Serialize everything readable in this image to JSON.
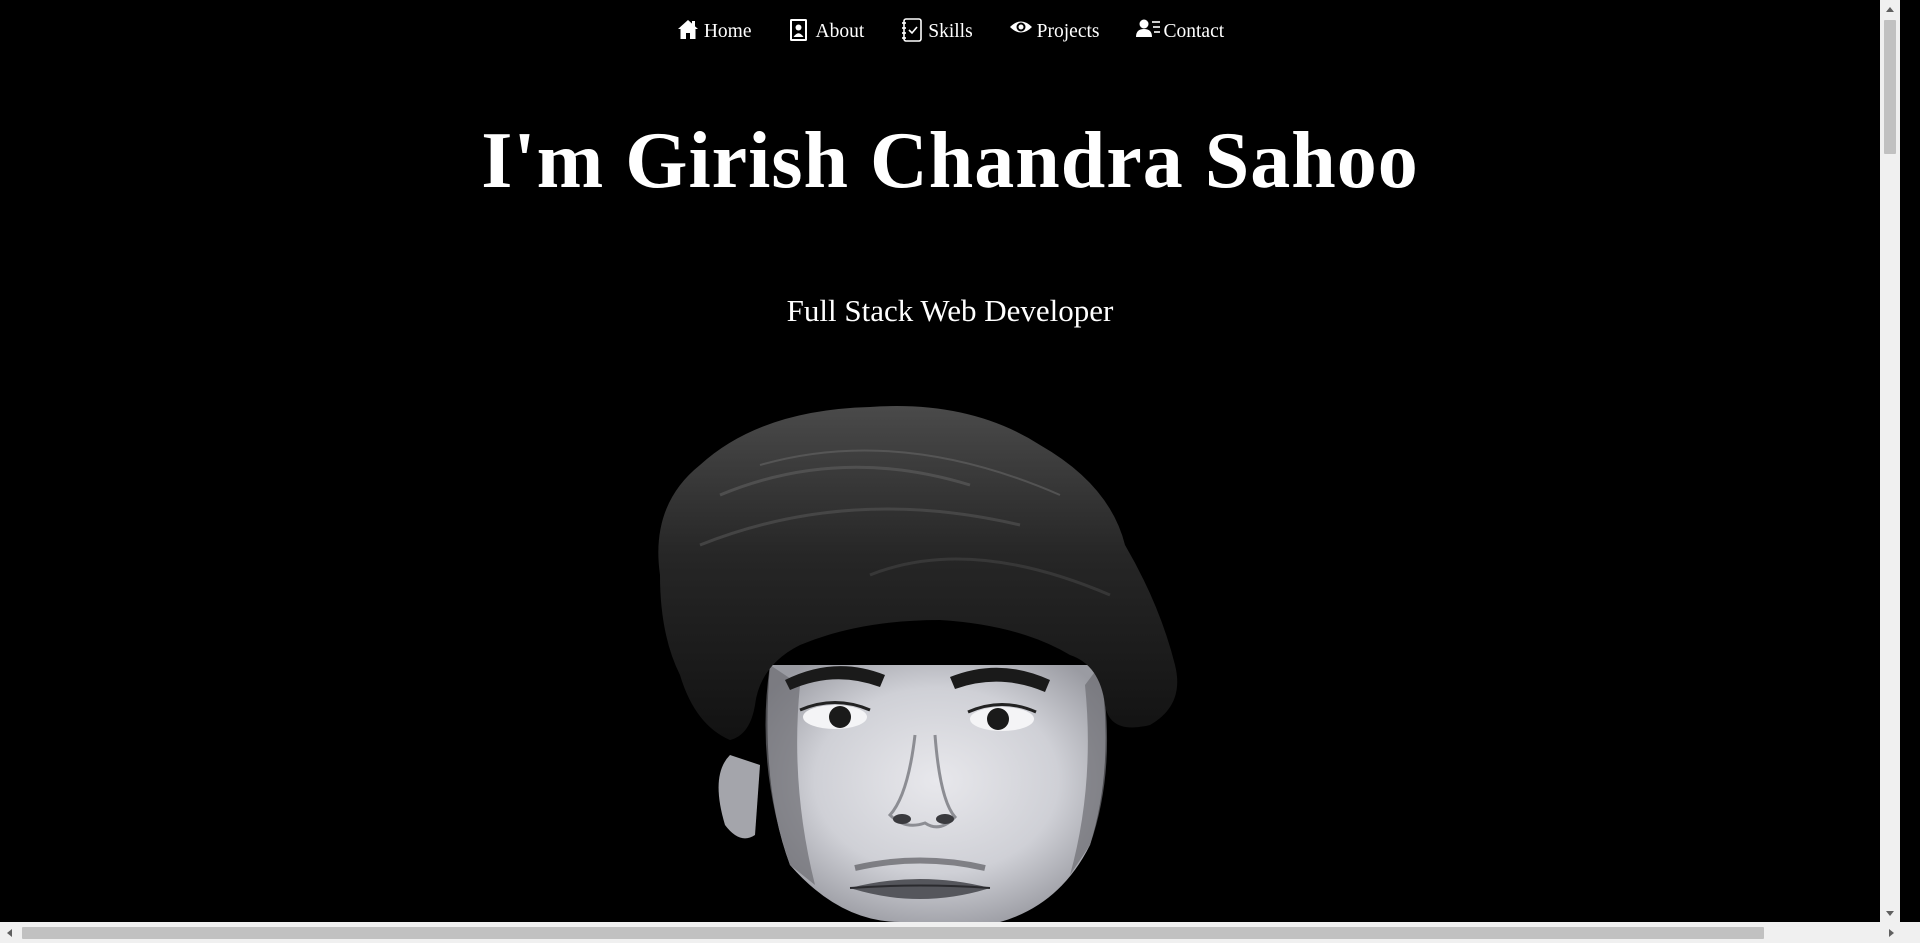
{
  "nav": {
    "items": [
      {
        "label": "Home",
        "icon": "home-icon"
      },
      {
        "label": "About",
        "icon": "contact-card-icon"
      },
      {
        "label": "Skills",
        "icon": "checklist-icon"
      },
      {
        "label": "Projects",
        "icon": "eye-icon"
      },
      {
        "label": "Contact",
        "icon": "user-list-icon"
      }
    ]
  },
  "hero": {
    "title": "I'm Girish Chandra Sahoo",
    "subtitle": "Full Stack Web Developer"
  },
  "portrait": {
    "description_icon": "portrait-photo"
  },
  "colors": {
    "background": "#000000",
    "text": "#ffffff",
    "scrollbar_track": "#f0f0f0",
    "scrollbar_thumb": "#c1c1c1"
  }
}
